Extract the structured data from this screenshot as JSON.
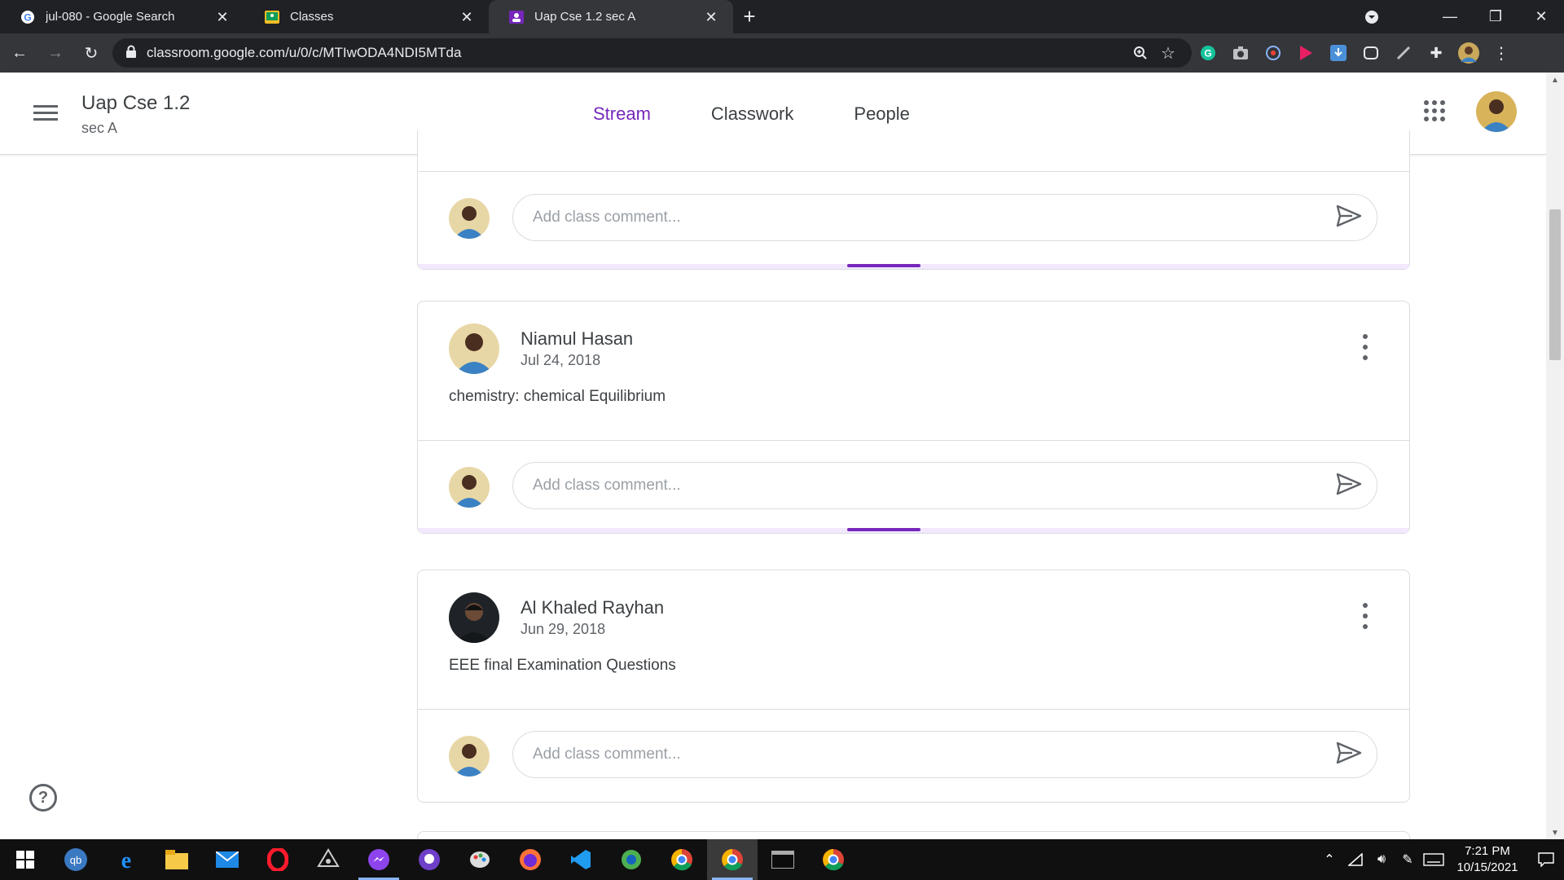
{
  "browser": {
    "tabs": [
      {
        "label": "jul-080 - Google Search",
        "favicon": "google-icon",
        "active": false
      },
      {
        "label": "Classes",
        "favicon": "classroom-icon",
        "active": false
      },
      {
        "label": "Uap Cse 1.2 sec A",
        "favicon": "classroom-icon",
        "active": true
      }
    ],
    "url": "classroom.google.com/u/0/c/MTIwODA4NDI5MTda"
  },
  "header": {
    "class_title": "Uap Cse 1.2",
    "class_section": "sec A",
    "tabs": [
      {
        "label": "Stream",
        "active": true
      },
      {
        "label": "Classwork",
        "active": false
      },
      {
        "label": "People",
        "active": false
      }
    ]
  },
  "stream": {
    "comment_placeholder": "Add class comment...",
    "posts": [
      {
        "author": "Niamul Hasan",
        "date": "Jul 24, 2018",
        "text": "chemistry: chemical Equilibrium"
      },
      {
        "author": "Al Khaled Rayhan",
        "date": "Jun 29, 2018",
        "text": "EEE final Examination Questions"
      }
    ]
  },
  "taskbar": {
    "apps": [
      "windows-start-icon",
      "qbittorrent-icon",
      "edge-icon",
      "file-explorer-icon",
      "mail-icon",
      "opera-icon",
      "inkscape-icon",
      "messenger-icon",
      "github-desktop-icon",
      "paint-icon",
      "firefox-icon",
      "vscode-icon",
      "android-studio-icon",
      "chrome-icon",
      "chrome-icon",
      "terminal-icon",
      "chrome-icon"
    ],
    "time": "7:21 PM",
    "date": "10/15/2021"
  },
  "colors": {
    "accent": "#7627bb",
    "chrome_dark": "#202124",
    "chrome_toolbar": "#35363a"
  }
}
